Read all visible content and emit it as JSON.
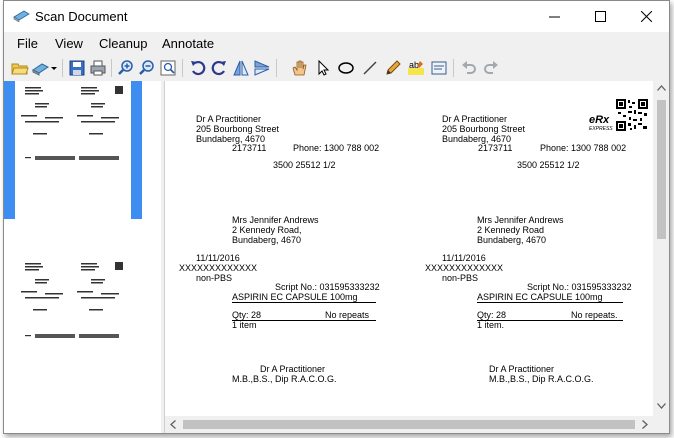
{
  "window": {
    "title": "Scan Document"
  },
  "menu": [
    "File",
    "View",
    "Cleanup",
    "Annotate"
  ],
  "toolbar_icons": [
    "open-folder-icon",
    "scan-icon",
    "dropdown-arrow-icon",
    "save-icon",
    "print-icon",
    "zoom-in-icon",
    "zoom-out-icon",
    "zoom-fit-icon",
    "rotate-left-icon",
    "rotate-right-icon",
    "flip-vertical-icon",
    "flip-horizontal-icon",
    "pan-hand-icon",
    "select-pointer-icon",
    "ellipse-icon",
    "line-icon",
    "pen-icon",
    "highlight-text-icon",
    "note-icon",
    "undo-icon",
    "redo-icon"
  ],
  "scripts": [
    {
      "doctor_name": "Dr A Practitioner",
      "address1": "205 Bourbong Street",
      "address2": "Bundaberg,   4670",
      "prescriber_no": "2173711",
      "phone": "Phone:   1300 788 002",
      "ref": "3500 25512 1/2",
      "patient_name": "Mrs Jennifer Andrews",
      "patient_addr1": "2 Kennedy Road,",
      "patient_addr2": "Bundaberg,  4670",
      "date": "11/11/2016",
      "medicare": "XXXXXXXXXXXXX",
      "pbs": "non-PBS",
      "script_no": "Script No.: 031595333232",
      "drug": "ASPIRIN EC CAPSULE 100mg",
      "qty": "Qty: 28",
      "repeats": "No repeats",
      "items": "1 item",
      "sign_name": "Dr A Practitioner",
      "quals": "M.B.,B.S., Dip R.A.C.O.G."
    },
    {
      "doctor_name": "Dr A Practitioner",
      "address1": "205 Bourbong Street",
      "address2": "Bundaberg,   4670",
      "prescriber_no": "2173711",
      "phone": "Phone:   1300 788 002",
      "ref": "3500 25512 1/2",
      "patient_name": "Mrs Jennifer Andrews",
      "patient_addr1": "2 Kennedy Road",
      "patient_addr2": "Bundaberg,  4670",
      "date": "11/11/2016",
      "medicare": "XXXXXXXXXXXXX",
      "pbs": "non-PBS",
      "script_no": "Script No.: 031595333232",
      "drug": "ASPIRIN EC CAPSULE 100mg",
      "qty": "Qty: 28",
      "repeats": "No repeats.",
      "items": "1 item.",
      "sign_name": "Dr A Practitioner",
      "quals": "M.B.,B.S., Dip R.A.C.O.G."
    }
  ],
  "erx_logo": {
    "main": "eRx",
    "sub": "EXPRESS"
  },
  "colors": {
    "thumb_selected": "#3d8ef0",
    "window_bg": "#f0f0f0"
  }
}
